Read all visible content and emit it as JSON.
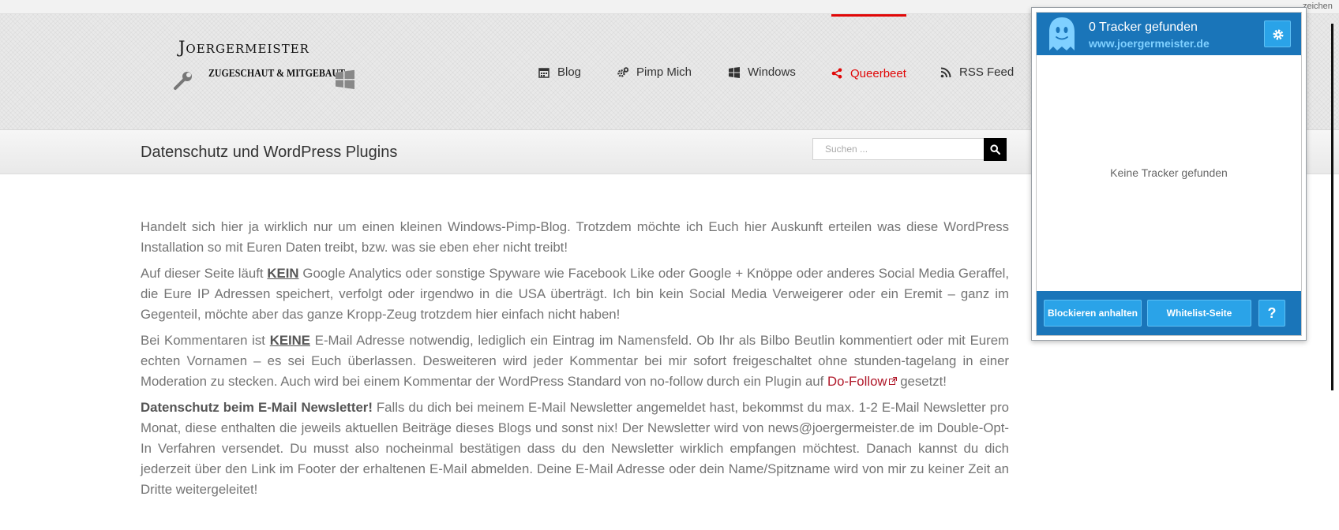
{
  "browser": {
    "hint_text": "zeichen"
  },
  "header": {
    "logo_title": "Joergermeister",
    "logo_subtitle": "ZUGESCHAUT & MITGEBAUT",
    "nav": [
      {
        "label": "Blog",
        "icon": "calendar-icon"
      },
      {
        "label": "Pimp Mich",
        "icon": "gears-icon"
      },
      {
        "label": "Windows",
        "icon": "windows-icon"
      },
      {
        "label": "Queerbeet",
        "icon": "share-icon",
        "active": true
      },
      {
        "label": "RSS Feed",
        "icon": "rss-icon"
      }
    ],
    "active_color": "#e10707"
  },
  "title_bar": {
    "page_title": "Datenschutz und WordPress Plugins",
    "search_placeholder": "Suchen ..."
  },
  "content": {
    "p1": "Handelt sich hier ja wirklich nur um einen kleinen Windows-Pimp-Blog. Trotzdem möchte ich Euch hier Auskunft erteilen was diese WordPress Installation so mit Euren Daten treibt, bzw. was sie eben eher nicht treibt!",
    "p2_before": "Auf dieser Seite läuft ",
    "p2_emph": "KEIN",
    "p2_after": " Google Analytics oder sonstige Spyware wie Facebook Like oder Google + Knöppe oder anderes Social Media Geraffel, die Eure IP Adressen speichert, verfolgt  oder irgendwo in die USA überträgt. Ich bin kein Social Media Verweigerer oder ein Eremit – ganz im Gegenteil, möchte aber das ganze Kropp-Zeug trotzdem hier einfach nicht haben!",
    "p3_before": "Bei Kommentaren ist ",
    "p3_emph": "KEINE",
    "p3_after": " E-Mail Adresse notwendig, lediglich ein Eintrag im Namensfeld. Ob Ihr als Bilbo Beutlin kommentiert oder mit Eurem echten Vornamen – es sei Euch überlassen. Desweiteren wird jeder Kommentar bei mir sofort freigeschaltet ohne stunden-tagelang in einer Moderation zu stecken. Auch wird bei einem Kommentar der WordPress Standard von no-follow durch ein Plugin auf ",
    "p3_link": "Do-Follow",
    "p3_end": " gesetzt!",
    "p4_strong": "Datenschutz beim E-Mail Newsletter!",
    "p4_rest": " Falls du dich bei meinem E-Mail Newsletter angemeldet hast, bekommst du max. 1-2 E-Mail Newsletter pro Monat, diese enthalten die jeweils aktuellen Beiträge dieses Blogs und sonst nix! Der Newsletter wird von news@joergermeister.de im Double-Opt-In Verfahren versendet. Du musst also nocheinmal bestätigen dass du den Newsletter wirklich empfangen möchtest. Danach kannst du dich jederzeit über den Link im Footer der erhaltenen E-Mail abmelden. Deine E-Mail Adresse oder dein Name/Spitzname wird von mir zu keiner Zeit an Dritte weitergeleitet!"
  },
  "ghostery": {
    "tracker_count": "0 Tracker gefunden",
    "site": "www.joergermeister.de",
    "empty_message": "Keine Tracker gefunden",
    "block_button": "Blockieren anhalten",
    "whitelist_button": "Whitelist-Seite",
    "help_button": "?",
    "brand_color": "#1a75b9",
    "button_color": "#2aa3e8"
  }
}
